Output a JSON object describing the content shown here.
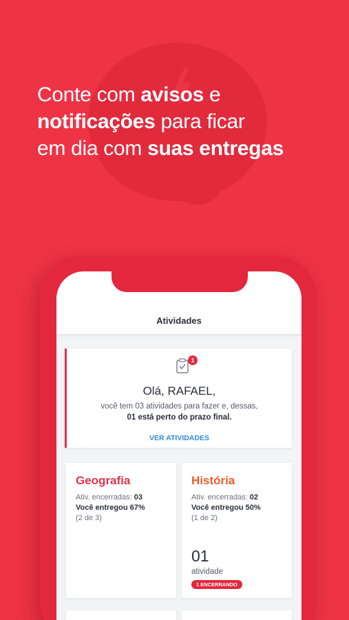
{
  "headline": {
    "line1_regular": "Conte com ",
    "line1_bold": "avisos",
    "line1_end": " e",
    "line2_bold": "notificações",
    "line2_regular": " para ficar",
    "line3_regular": "em dia com ",
    "line3_bold": "suas entregas"
  },
  "screen": {
    "title": "Atividades"
  },
  "welcome": {
    "badge_count": "1",
    "greeting": "Olá, RAFAEL,",
    "line1": "você tem 03 atividades para fazer e, dessas,",
    "line2": "01 está perto do prazo final.",
    "link": "VER ATIVIDADES"
  },
  "subjects": [
    {
      "name": "Geografia",
      "closed_label": "Ativ. encerradas: ",
      "closed_value": "03",
      "delivered": "Você entregou 67%",
      "ratio": "(2 de 3)"
    },
    {
      "name": "História",
      "closed_label": "Ativ. encerradas: ",
      "closed_value": "02",
      "delivered": "Você entregou 50%",
      "ratio": "(1 de 2)",
      "count": "01",
      "count_label": "atividade",
      "pill": "1 ENCERRANDO"
    }
  ],
  "colors": {
    "background": "#ee3346",
    "phone": "#e3283d",
    "accent_red": "#e8304a",
    "accent_orange": "#ef5a2b",
    "link_blue": "#2d8bd6"
  },
  "icons": {
    "background": "lightning-bubble-icon",
    "task": "clipboard-check-icon"
  }
}
